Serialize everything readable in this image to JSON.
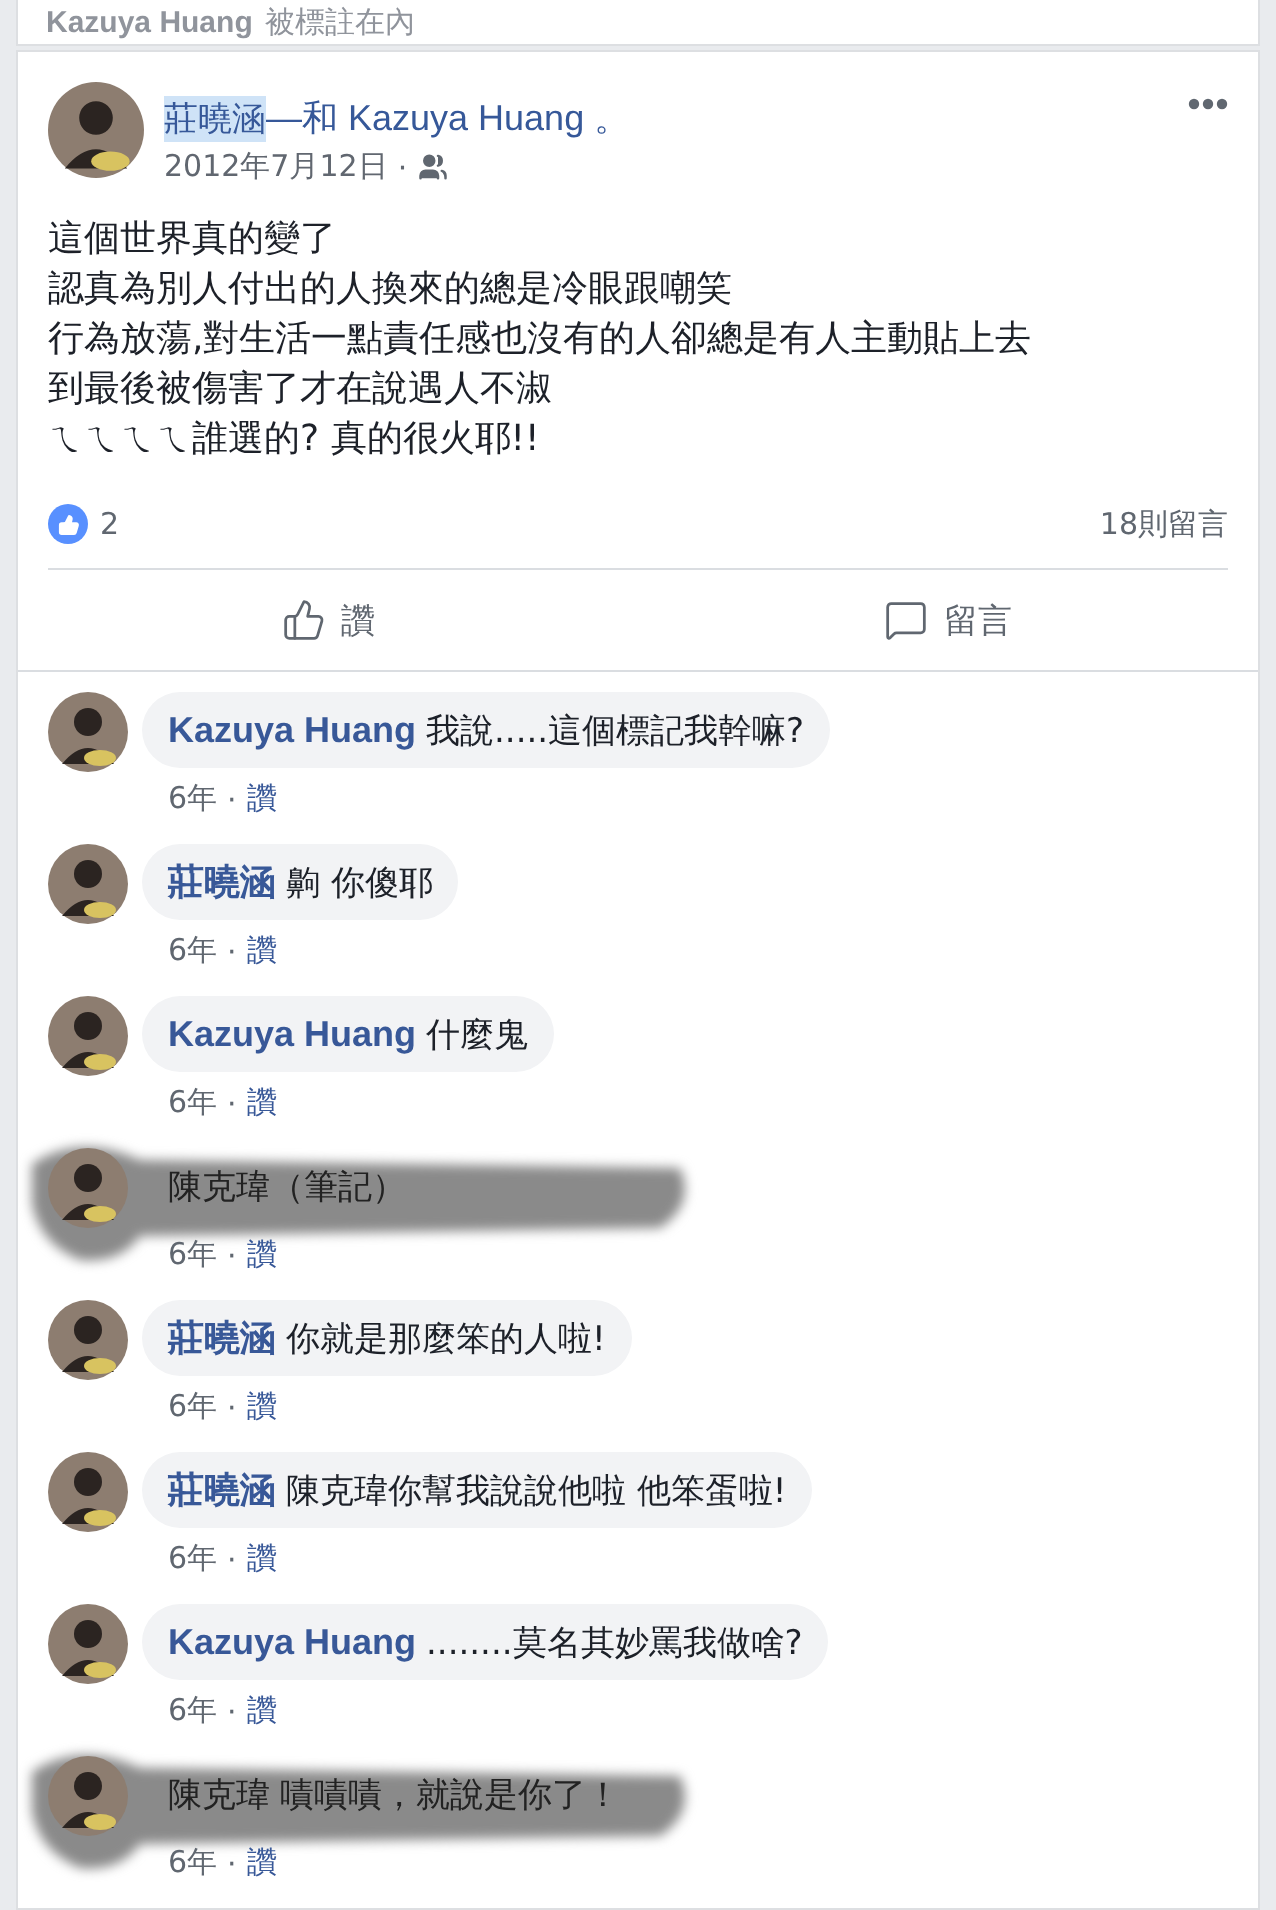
{
  "header": {
    "name": "Kazuya Huang",
    "text": "被標註在內"
  },
  "post": {
    "author": "莊曉涵",
    "author_highlighted": true,
    "with_text": "—和 Kazuya Huang 。",
    "date": "2012年7月12日",
    "dot": "·",
    "body": [
      "這個世界真的變了",
      "認真為別人付出的人換來的總是冷眼跟嘲笑",
      "行為放蕩,對生活一點責任感也沒有的人卻總是有人主動貼上去",
      "到最後被傷害了才在說遇人不淑",
      "ㄟㄟㄟㄟ誰選的? 真的很火耶!!"
    ],
    "likes": "2",
    "comments_count": "18則留言"
  },
  "actions": [
    {
      "kind": "like",
      "label": "讚"
    },
    {
      "kind": "comment",
      "label": "留言"
    }
  ],
  "comments": [
    {
      "name": "Kazuya Huang",
      "text": "我說.....這個標記我幹嘛?",
      "time": "6年",
      "dot": "·",
      "like": "讚",
      "redacted": false
    },
    {
      "name": "莊曉涵",
      "text": "齁 你傻耶",
      "time": "6年",
      "dot": "·",
      "like": "讚",
      "redacted": false
    },
    {
      "name": "Kazuya Huang",
      "text": "什麼鬼",
      "time": "6年",
      "dot": "·",
      "like": "讚",
      "redacted": false
    },
    {
      "name": "陳克瑋（筆記）",
      "time": "6年",
      "dot": "·",
      "like": "讚",
      "redacted": true
    },
    {
      "name": "莊曉涵",
      "text": "你就是那麼笨的人啦!",
      "time": "6年",
      "dot": "·",
      "like": "讚",
      "redacted": false
    },
    {
      "name": "莊曉涵",
      "text": "陳克瑋你幫我說說他啦 他笨蛋啦!",
      "time": "6年",
      "dot": "·",
      "like": "讚",
      "redacted": false
    },
    {
      "name": "Kazuya Huang",
      "text": "........莫名其妙罵我做啥?",
      "time": "6年",
      "dot": "·",
      "like": "讚",
      "redacted": false
    },
    {
      "name": "陳克瑋",
      "text": "嘖嘖嘖，就說是你了！",
      "time": "6年",
      "dot": "·",
      "like": "讚",
      "redacted": true
    }
  ]
}
